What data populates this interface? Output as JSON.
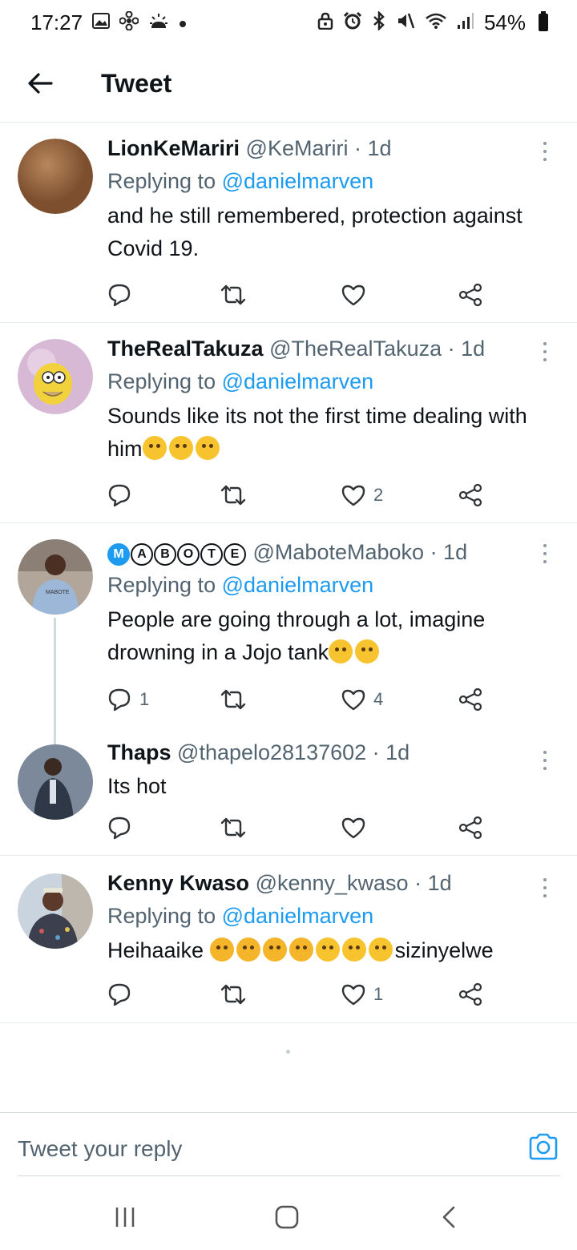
{
  "status_bar": {
    "time": "17:27",
    "battery": "54%",
    "left_icons": [
      "image-icon",
      "fan-icon",
      "weather-icon",
      "dot-icon"
    ],
    "right_icons": [
      "lock-icon",
      "alarm-icon",
      "bluetooth-icon",
      "mute-icon",
      "wifi-icon",
      "signal-icon"
    ]
  },
  "header": {
    "title": "Tweet"
  },
  "tweets": [
    {
      "name": "LionKeMariri",
      "handle": "@KeMariri",
      "time": "· 1d",
      "replying_label": "Replying to",
      "replying_to": "@danielmarven",
      "text": "and he still remembered, protection against Covid 19.",
      "replies": "",
      "likes": "",
      "avatar_color": "#9a6a44"
    },
    {
      "name": "TheRealTakuza",
      "handle": "@TheRealTakuza",
      "time": "· 1d",
      "replying_label": "Replying to",
      "replying_to": "@danielmarven",
      "text": "Sounds like its not the first time dealing with him",
      "replies": "",
      "likes": "2",
      "avatar_color": "#e8c24a"
    },
    {
      "name_badges": [
        "M",
        "A",
        "B",
        "O",
        "T",
        "E"
      ],
      "handle": "@MaboteMaboko",
      "time": "· 1d",
      "replying_label": "Replying to",
      "replying_to": "@danielmarven",
      "text": "People are going through a lot, imagine drowning in a Jojo tank",
      "replies": "1",
      "likes": "4",
      "avatar_color": "#7a8aa0"
    },
    {
      "name": "Thaps",
      "handle": "@thapelo28137602",
      "time": "· 1d",
      "text": "Its  hot",
      "replies": "",
      "likes": "",
      "avatar_color": "#5a6a80"
    },
    {
      "name": "Kenny Kwaso",
      "handle": "@kenny_kwaso",
      "time": "· 1d",
      "replying_label": "Replying to",
      "replying_to": "@danielmarven",
      "text_before": "Heihaaike",
      "text_after": "sizinyelwe",
      "replies": "",
      "likes": "1",
      "avatar_color": "#9fb5c8"
    }
  ],
  "reply_bar": {
    "placeholder": "Tweet your reply"
  },
  "colors": {
    "link": "#1d9bf0",
    "secondary_text": "#536471",
    "divider": "#e6ecf0"
  }
}
